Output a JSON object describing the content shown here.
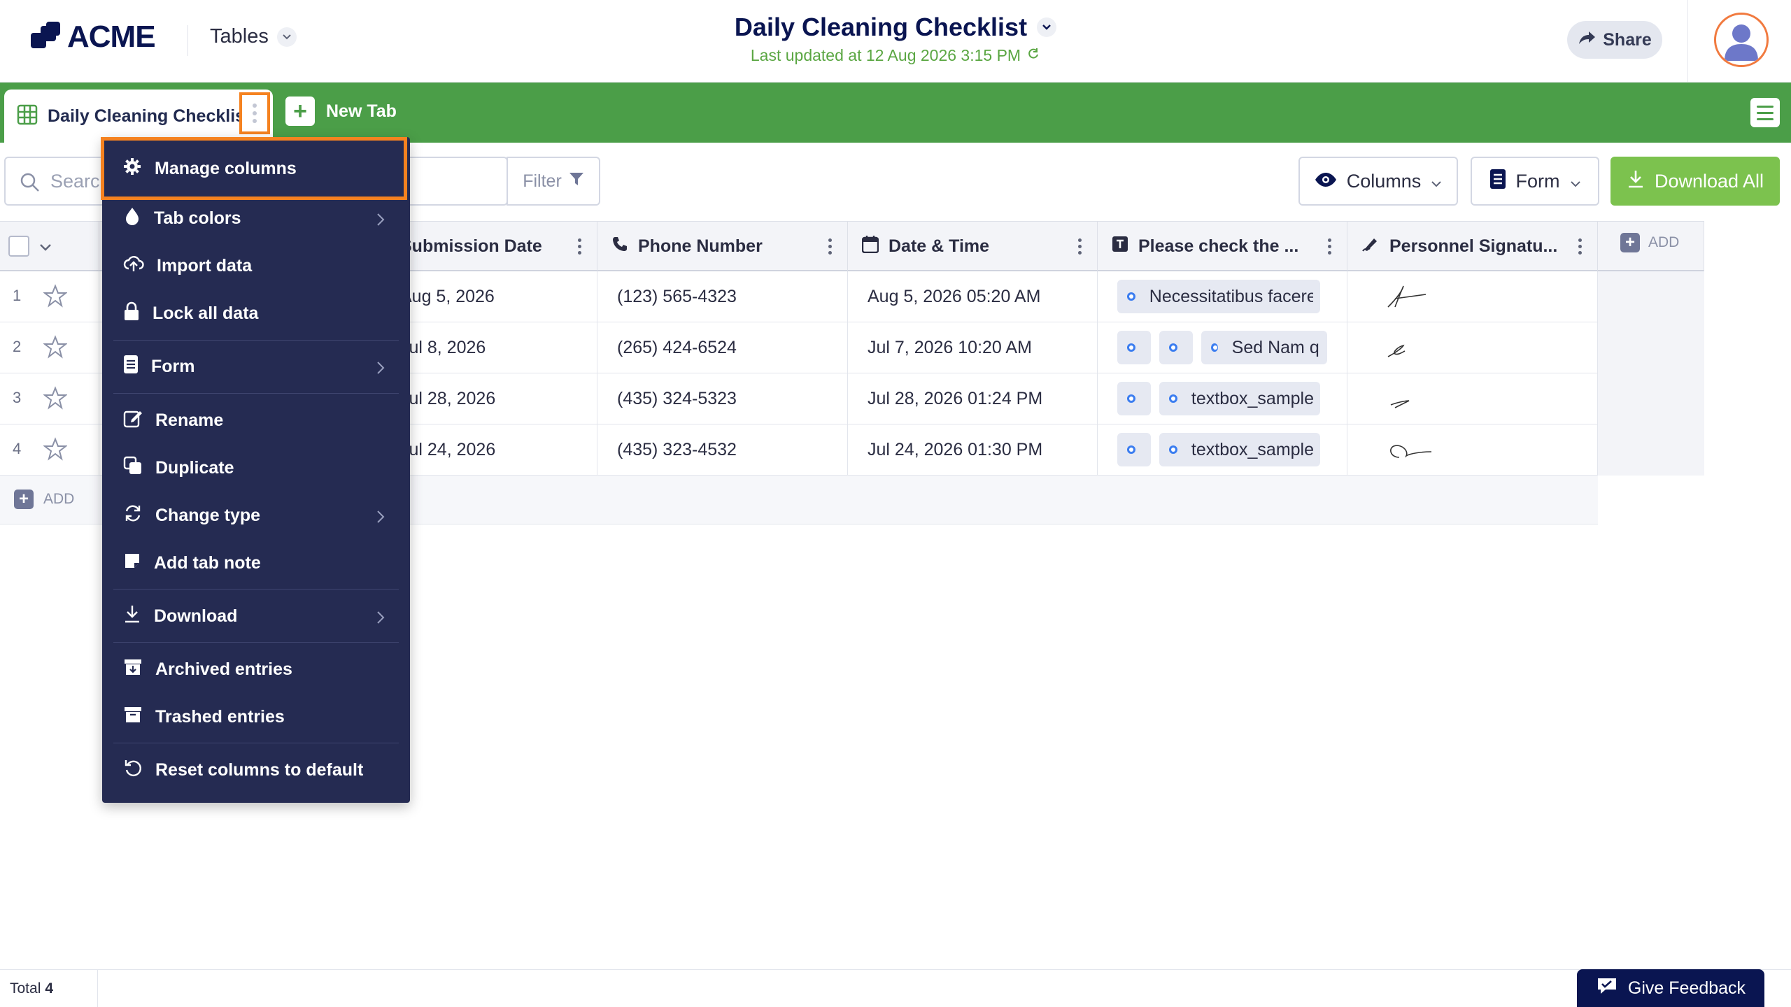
{
  "app": {
    "logo_text": "ACME",
    "section_label": "Tables",
    "title": "Daily Cleaning Checklist",
    "subtitle": "Last updated at 12 Aug 2026 3:15 PM",
    "share_label": "Share"
  },
  "tabs": {
    "active_label": "Daily Cleaning Checklist",
    "new_tab_label": "New Tab"
  },
  "toolbar": {
    "search_placeholder": "Search",
    "filter_label": "Filter",
    "columns_label": "Columns",
    "form_label": "Form",
    "download_all_label": "Download All"
  },
  "table": {
    "columns": [
      "Submission Date",
      "Phone Number",
      "Date & Time",
      "Please check the ...",
      "Personnel Signatu..."
    ],
    "add_column_label": "ADD",
    "add_row_label": "ADD",
    "rows": [
      {
        "num": "1",
        "submission": "Aug 5, 2026",
        "phone": "(123) 565-4323",
        "datetime": "Aug 5, 2026 05:20 AM",
        "check_text": "Necessitatibus facere"
      },
      {
        "num": "2",
        "submission": "Jul 8, 2026",
        "phone": "(265) 424-6524",
        "datetime": "Jul 7, 2026 10:20 AM",
        "check_text": "Sed Nam quis"
      },
      {
        "num": "3",
        "submission": "Jul 28, 2026",
        "phone": "(435) 324-5323",
        "datetime": "Jul 28, 2026 01:24 PM",
        "check_text": "textbox_sample"
      },
      {
        "num": "4",
        "submission": "Jul 24, 2026",
        "phone": "(435) 323-4532",
        "datetime": "Jul 24, 2026 01:30 PM",
        "check_text": "textbox_sample"
      }
    ]
  },
  "context_menu": {
    "items": [
      {
        "label": "Manage columns",
        "icon": "gear-icon"
      },
      {
        "label": "Tab colors",
        "icon": "drop-icon"
      },
      {
        "label": "Import data",
        "icon": "cloud-upload-icon"
      },
      {
        "label": "Lock all data",
        "icon": "lock-icon"
      },
      {
        "label": "Form",
        "icon": "form-icon"
      },
      {
        "label": "Rename",
        "icon": "edit-icon"
      },
      {
        "label": "Duplicate",
        "icon": "duplicate-icon"
      },
      {
        "label": "Change type",
        "icon": "refresh-icon"
      },
      {
        "label": "Add tab note",
        "icon": "note-icon"
      },
      {
        "label": "Download",
        "icon": "download-icon"
      },
      {
        "label": "Archived entries",
        "icon": "archive-icon"
      },
      {
        "label": "Trashed entries",
        "icon": "trash-box-icon"
      },
      {
        "label": "Reset columns to default",
        "icon": "reset-icon"
      }
    ]
  },
  "footer": {
    "total_label": "Total",
    "total_count": "4",
    "feedback_label": "Give Feedback"
  },
  "colors": {
    "brand_navy": "#0a1551",
    "tab_bar_green": "#4b9e48",
    "download_green": "#7cc24e",
    "menu_bg": "#252b52",
    "highlight_orange": "#f58220"
  }
}
